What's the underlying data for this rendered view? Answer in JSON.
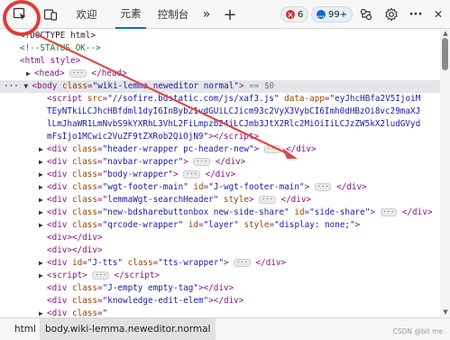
{
  "toolbar": {
    "tabs": [
      {
        "label": "欢迎",
        "active": false
      },
      {
        "label": "元素",
        "active": true
      },
      {
        "label": "控制台",
        "active": false
      }
    ],
    "more_label": "»",
    "add_label": "+",
    "error_count": "6",
    "info_count": "99+",
    "more_options": "···",
    "close": "✕"
  },
  "code": {
    "doctype": "<!DOCTYPE html>",
    "comment": "<!--STATUS OK-->",
    "html_open": "<html style>",
    "head": "head",
    "body_class": "wiki-lemma neweditor normal",
    "sel_marker": "== $0",
    "script_src": "//sofire.bdstatic.com/js/xaf3.js",
    "script_app_line1": "eyJhcHBfa2V5IjoiM",
    "script_app_line2": "TEyNTkiLCJhcHBfdml1dyI6InByb21vdGUiLCJicm93c2VyX3VybCI6Imh0dHBzOi8vc29maXJ",
    "script_app_line3": "lLmJhaWR1LmNvbS9kYXRhL3VhL2FiLmpzb24iLCJmb3JtX2Rlc2MiOiIiLCJzZW5kX2ludGVyd",
    "script_app_line4": "mFsIjo1MCwic2VuZF9tZXRob2QiOjN9",
    "divs": [
      {
        "cls": "header-wrapper pc-header-new",
        "extra": ""
      },
      {
        "cls": "navbar-wrapper",
        "extra": ""
      },
      {
        "cls": "body-wrapper",
        "extra": ""
      },
      {
        "cls": "wgt-footer-main",
        "extra": "J-wgt-footer-main"
      },
      {
        "cls": "lemmaWgt-searchHeader",
        "extra": ""
      },
      {
        "cls": "new-bdsharebuttonbox new-side-share",
        "extra": "side-share"
      },
      {
        "cls": "qrcode-wrapper",
        "extra": "layer"
      }
    ],
    "style_val": "display: none;",
    "id_tts": "J-tts",
    "cls_tts": "tts-wrapper",
    "cls_empty": "J-empty empty-tag",
    "cls_knowledge": "knowledge-edit-elem"
  },
  "breadcrumb": {
    "items": [
      "html",
      "body.wiki-lemma.neweditor.normal"
    ]
  },
  "watermark": "CSDN @bit me"
}
